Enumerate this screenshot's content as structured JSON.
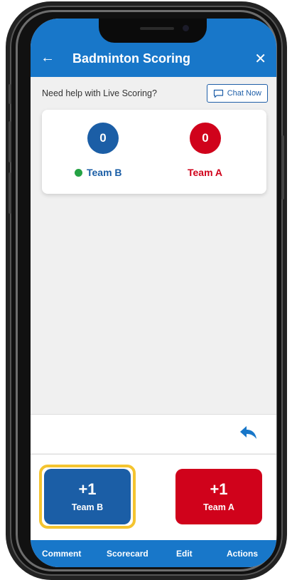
{
  "app": {
    "title": "Badminton Scoring",
    "back_icon": "arrow-left-icon",
    "close_icon": "close-icon"
  },
  "help": {
    "text": "Need help with Live Scoring?",
    "chat_label": "Chat Now",
    "chat_icon": "chat-bubble-icon"
  },
  "scoreboard": {
    "team_b": {
      "name": "Team B",
      "score": "0",
      "color": "#1b5ea6",
      "serving": true
    },
    "team_a": {
      "name": "Team A",
      "score": "0",
      "color": "#d0021b"
    }
  },
  "undo": {
    "icon": "undo-arrow-icon"
  },
  "actions": {
    "team_b": {
      "plus": "+1",
      "label": "Team B",
      "color": "#1b5ea6"
    },
    "team_a": {
      "plus": "+1",
      "label": "Team A",
      "color": "#d0021b"
    },
    "highlight_color": "#f4c430"
  },
  "bottom_nav": {
    "comment": "Comment",
    "scorecard": "Scorecard",
    "edit": "Edit",
    "actions": "Actions"
  },
  "colors": {
    "primary": "#1877c9",
    "background": "#f0f0f0"
  }
}
